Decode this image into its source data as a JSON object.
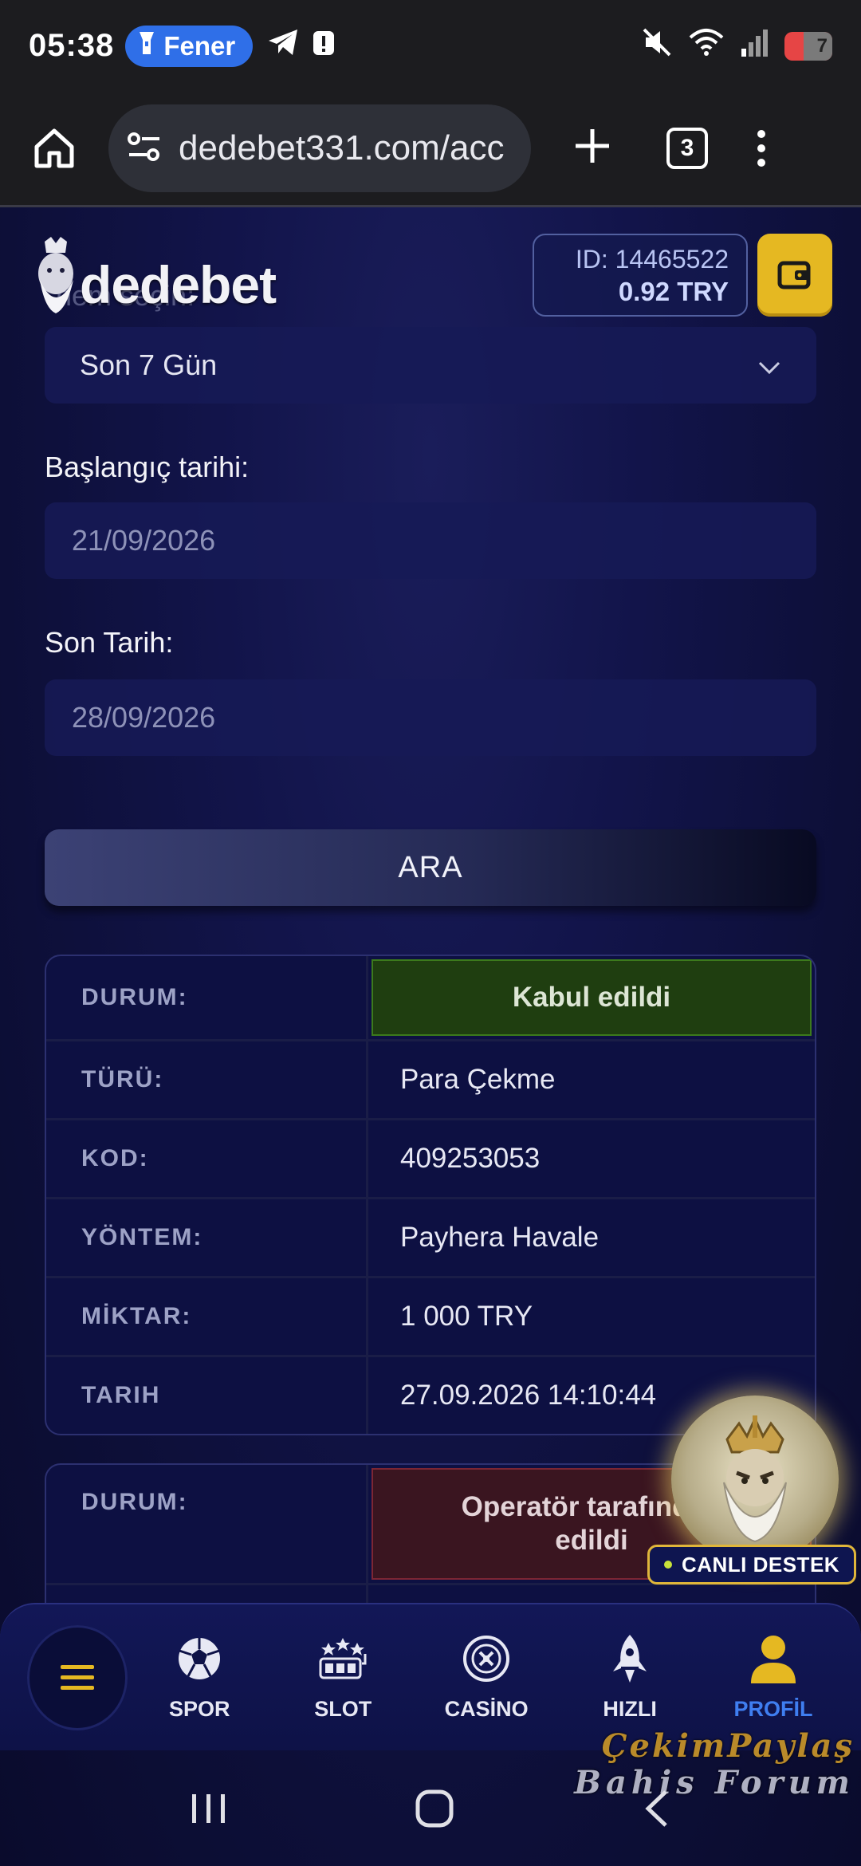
{
  "status_bar": {
    "time": "05:38",
    "pill_label": "Fener",
    "battery": "7"
  },
  "browser": {
    "url": "dedebet331.com/acc",
    "tab_count": "3"
  },
  "header": {
    "logo_text": "dedebet",
    "balance_id": "ID: 14465522",
    "balance_amount": "0.92   TRY"
  },
  "filters": {
    "period_label_partial": "nem seçin:",
    "period_value": "Son 7 Gün",
    "start_label": "Başlangıç tarihi:",
    "start_value": "21/09/2026",
    "end_label": "Son Tarih:",
    "end_value": "28/09/2026",
    "search_button": "ARA"
  },
  "transactions": [
    {
      "status_key": "DURUM:",
      "status_value": "Kabul edildi",
      "rows": [
        {
          "key": "TÜRÜ:",
          "value": "Para Çekme"
        },
        {
          "key": "KOD:",
          "value": "409253053"
        },
        {
          "key": "YÖNTEM:",
          "value": "Payhera Havale"
        },
        {
          "key": "MİKTAR:",
          "value": "1 000 TRY"
        },
        {
          "key": "TARIH",
          "value": "27.09.2026 14:10:44"
        }
      ]
    },
    {
      "status_key": "DURUM:",
      "status_value": "Operatör tarafından\nedildi"
    }
  ],
  "support": {
    "label": "CANLI DESTEK"
  },
  "bottom_nav": {
    "items": [
      {
        "label": "SPOR",
        "icon": "soccer-ball-icon"
      },
      {
        "label": "SLOT",
        "icon": "slot-machine-icon"
      },
      {
        "label": "CASİNO",
        "icon": "roulette-icon"
      },
      {
        "label": "HIZLI",
        "icon": "rocket-icon"
      },
      {
        "label": "PROFİL",
        "icon": "user-icon"
      }
    ],
    "active": "PROFİL"
  },
  "watermark": {
    "line1": "ÇekimPaylaş",
    "line2": "Bahis Forum"
  },
  "colors": {
    "accent_gold": "#e5b822",
    "active_blue": "#3f7ef0",
    "accepted_green": "#1f3e10",
    "cancelled_red": "#3a1520"
  }
}
